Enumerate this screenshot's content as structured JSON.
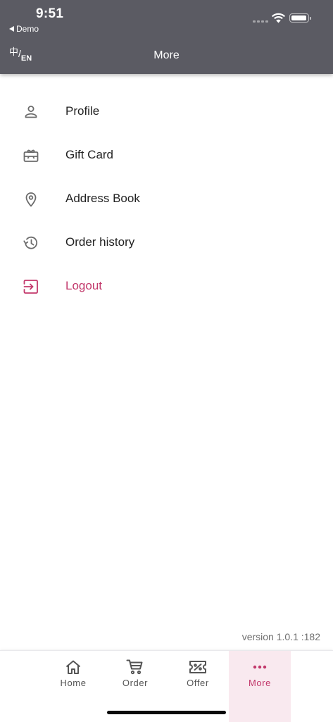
{
  "status_bar": {
    "time": "9:51",
    "back_app": "Demo"
  },
  "header": {
    "lang_zh": "中",
    "lang_sep": "/",
    "lang_en": "EN",
    "title": "More"
  },
  "menu": {
    "items": [
      {
        "label": "Profile",
        "icon": "person-icon"
      },
      {
        "label": "Gift Card",
        "icon": "gift-card-icon"
      },
      {
        "label": "Address Book",
        "icon": "location-pin-icon"
      },
      {
        "label": "Order history",
        "icon": "history-icon"
      },
      {
        "label": "Logout",
        "icon": "logout-icon"
      }
    ]
  },
  "version": {
    "text": "version 1.0.1  :182"
  },
  "tabbar": {
    "tabs": [
      {
        "label": "Home",
        "icon": "home-icon"
      },
      {
        "label": "Order",
        "icon": "cart-icon"
      },
      {
        "label": "Offer",
        "icon": "ticket-icon"
      },
      {
        "label": "More",
        "icon": "more-dots-icon"
      }
    ],
    "active": "More"
  },
  "colors": {
    "header_bg": "#5b5b63",
    "accent": "#c2386b",
    "active_tab_bg": "#f9e9ef",
    "icon_gray": "#6b6b6b"
  }
}
